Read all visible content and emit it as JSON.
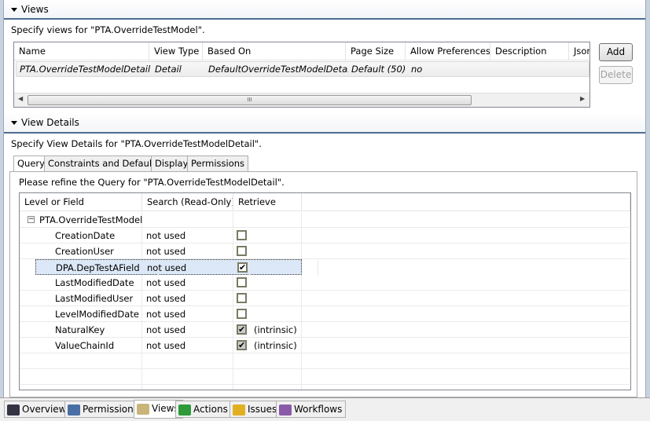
{
  "views_section": {
    "title": "Views",
    "description": "Specify views for \"PTA.OverrideTestModel\".",
    "columns": [
      "Name",
      "View Type",
      "Based On",
      "Page Size",
      "Allow Preferences",
      "Description",
      "Json List"
    ],
    "rows": [
      [
        "PTA.OverrideTestModelDetail",
        "Detail",
        "DefaultOverrideTestModelDetail",
        "Default (50)",
        "no",
        "",
        ""
      ]
    ],
    "add_label": "Add",
    "delete_label": "Delete",
    "scroll_grip": "III"
  },
  "details_section": {
    "title": "View Details",
    "description": "Specify View Details for \"PTA.OverrideTestModelDetail\".",
    "tabs": [
      "Query",
      "Constraints and Defaults",
      "Display",
      "Permissions"
    ],
    "query_text": "Please refine the Query for \"PTA.OverrideTestModelDetail\".",
    "columns": [
      "Level or Field",
      "Search (Read-Only)",
      "Retrieve"
    ],
    "root": "PTA.OverrideTestModel",
    "fields": [
      {
        "name": "CreationDate",
        "search": "not used",
        "retrieve": false,
        "note": ""
      },
      {
        "name": "CreationUser",
        "search": "not used",
        "retrieve": false,
        "note": ""
      },
      {
        "name": "DPA.DepTestAField",
        "search": "not used",
        "retrieve": true,
        "note": "",
        "selected": true
      },
      {
        "name": "LastModifiedDate",
        "search": "not used",
        "retrieve": false,
        "note": ""
      },
      {
        "name": "LastModifiedUser",
        "search": "not used",
        "retrieve": false,
        "note": ""
      },
      {
        "name": "LevelModifiedDate",
        "search": "not used",
        "retrieve": false,
        "note": ""
      },
      {
        "name": "NaturalKey",
        "search": "not used",
        "retrieve": true,
        "note": "(intrinsic)",
        "disabled": true
      },
      {
        "name": "ValueChainId",
        "search": "not used",
        "retrieve": true,
        "note": "(intrinsic)",
        "disabled": true
      }
    ]
  },
  "bottom_tabs": [
    {
      "label": "Overview",
      "icon": "binoculars-icon"
    },
    {
      "label": "Permissions",
      "icon": "person-icon"
    },
    {
      "label": "Views",
      "icon": "views-magnifier-icon",
      "selected": true
    },
    {
      "label": "Actions",
      "icon": "green-arrow-icon"
    },
    {
      "label": "Issues",
      "icon": "warning-icon"
    },
    {
      "label": "Workflows",
      "icon": "workflow-icon"
    }
  ],
  "colors": {
    "section_line": "#4f6d93",
    "selection": "#dce8f7"
  }
}
